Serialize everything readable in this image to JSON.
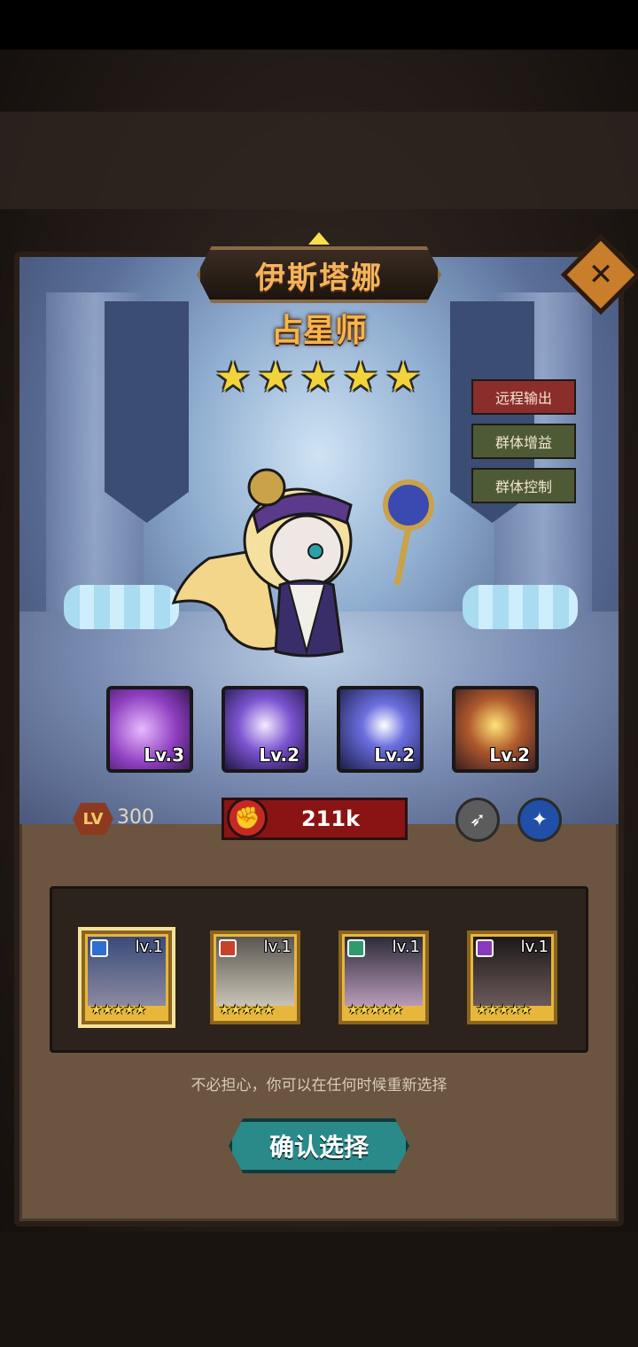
{
  "hero": {
    "name": "伊斯塔娜",
    "class_title": "占星师",
    "star_count": 5,
    "tags": [
      "远程输出",
      "群体增益",
      "群体控制"
    ],
    "level_badge": "LV",
    "level": "300",
    "power": "211k"
  },
  "skills": [
    {
      "level": "Lv.3",
      "icon": "purple-burst-icon"
    },
    {
      "level": "Lv.2",
      "icon": "star-light-icon"
    },
    {
      "level": "Lv.2",
      "icon": "crescent-star-icon"
    },
    {
      "level": "Lv.2",
      "icon": "gold-lightning-icon"
    }
  ],
  "class_icons": [
    "bow-icon",
    "staff-icon"
  ],
  "candidates": [
    {
      "level": "lv.1",
      "stars": "★★★★★",
      "class_color": "#2f6fcf",
      "selected": true
    },
    {
      "level": "lv.1",
      "stars": "★★★★★",
      "class_color": "#c6432a",
      "selected": false
    },
    {
      "level": "lv.1",
      "stars": "★★★★★",
      "class_color": "#2f9a6a",
      "selected": false
    },
    {
      "level": "lv.1",
      "stars": "★★★★★",
      "class_color": "#8a3ab8",
      "selected": false
    }
  ],
  "hint": "不必担心，你可以在任何时候重新选择",
  "confirm_label": "确认选择",
  "close_label": "✕"
}
